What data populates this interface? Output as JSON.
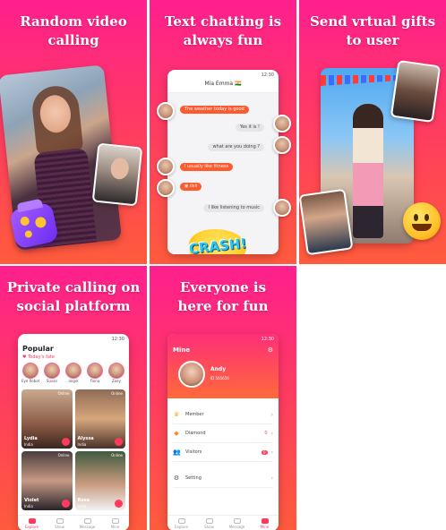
{
  "tiles": {
    "t1": {
      "headline_1": "Random video",
      "headline_2": "calling"
    },
    "t2": {
      "headline_1": "Text chatting is",
      "headline_2": "always fun"
    },
    "t3": {
      "headline_1": "Send vrtual gifts",
      "headline_2": "to user"
    },
    "t4": {
      "headline_1": "Private calling on",
      "headline_2": "social platform"
    },
    "t5": {
      "headline_1": "Everyone is",
      "headline_2": "here for fun"
    }
  },
  "status": {
    "time": "12:30"
  },
  "chat": {
    "title": "Mia Emma",
    "messages": [
      {
        "dir": "in",
        "text": "The weather today is good"
      },
      {
        "dir": "out",
        "text": "Yes it is !"
      },
      {
        "dir": "out",
        "text": "what are you doing ?"
      },
      {
        "dir": "in",
        "text": "I usually like fitness"
      },
      {
        "dir": "in",
        "text": "voice message"
      },
      {
        "dir": "out",
        "text": "I like listening to music"
      }
    ],
    "sticker": "CRASH!"
  },
  "popular": {
    "title": "Popular",
    "fate_label": "Today's fate",
    "fate": [
      "Eye Robot",
      "Susan",
      "angel",
      "Fiona",
      "Zoey"
    ],
    "cards": [
      {
        "name": "Lydia",
        "tag": "India",
        "status": "Online"
      },
      {
        "name": "Alyssa",
        "tag": "India",
        "status": "Online"
      },
      {
        "name": "Violet",
        "tag": "India",
        "status": "Online"
      },
      {
        "name": "Rose",
        "tag": "India",
        "status": "Online"
      }
    ],
    "tabs": [
      "Explore",
      "Show",
      "Message",
      "Mine"
    ]
  },
  "mine": {
    "title": "Mine",
    "name": "Andy",
    "id": "ID 565656",
    "rows": [
      {
        "label": "Member",
        "value": ""
      },
      {
        "label": "Diamond",
        "value": "0"
      },
      {
        "label": "Visitors",
        "value": "0"
      },
      {
        "label": "Setting",
        "value": ""
      }
    ],
    "tabs": [
      "Explore",
      "Show",
      "Message",
      "Mine"
    ]
  },
  "colors": {
    "accent": "#ff3a5c",
    "gradient_top": "#ff1f8e",
    "gradient_bottom": "#ff5b3c"
  }
}
